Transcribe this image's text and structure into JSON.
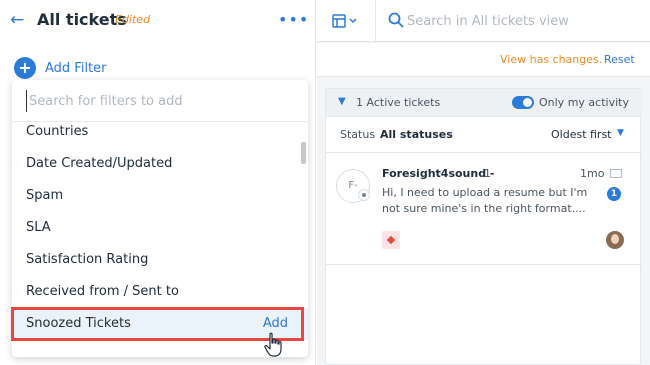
{
  "header": {
    "title": "All tickets",
    "edited_label": "Edited",
    "back_icon": "arrow-left-icon",
    "more_icon": "more-horizontal-icon"
  },
  "add_filter": {
    "label": "Add Filter",
    "icon": "plus-circle-icon"
  },
  "filter_dropdown": {
    "search_placeholder": "Search for filters to add",
    "items": [
      {
        "label": "Countries"
      },
      {
        "label": "Date Created/Updated"
      },
      {
        "label": "Spam"
      },
      {
        "label": "SLA"
      },
      {
        "label": "Satisfaction Rating"
      },
      {
        "label": "Received from / Sent to"
      },
      {
        "label": "Snoozed Tickets",
        "selected": true
      }
    ],
    "add_label": "Add"
  },
  "right": {
    "search_placeholder": "Search in All tickets view",
    "view_changes_text": "View has changes.",
    "reset_label": "Reset",
    "active_tickets": "1 Active tickets",
    "only_my_activity": "Only my activity",
    "status_label": "Status",
    "status_value": "All statuses",
    "sort_label": "Oldest first",
    "ticket": {
      "avatar_initials": "F-",
      "name": "Foresight4sound -",
      "count": "1",
      "time": "1mo",
      "preview": "Hi, I need to upload a resume but I'm not sure mine's in the right format....",
      "unread_count": "1"
    }
  },
  "colors": {
    "accent": "#2b7bd8",
    "warning": "#f08a24",
    "highlight": "#e8483f"
  }
}
